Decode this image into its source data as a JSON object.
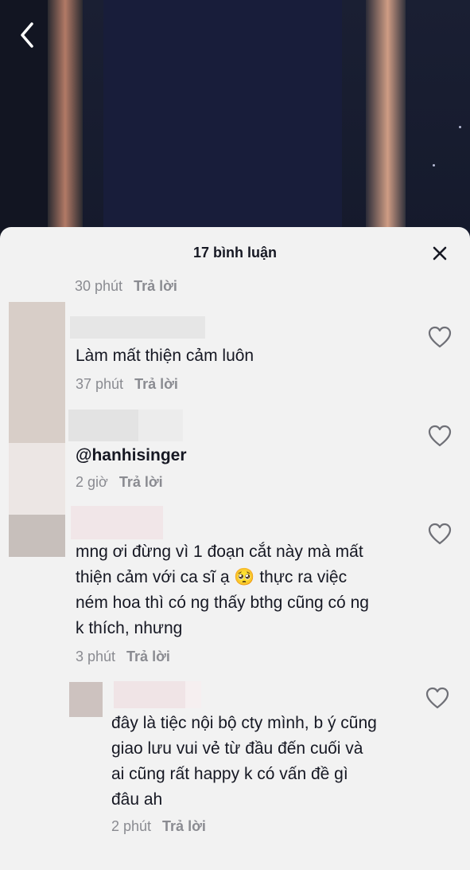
{
  "header": {
    "back_icon": "chevron-left-icon",
    "comment_count_title": "17 bình luận",
    "close_icon": "close-icon"
  },
  "comments": [
    {
      "time": "30 phút",
      "reply_label": "Trả lời",
      "text": ""
    },
    {
      "text": "Làm mất thiện cảm luôn",
      "time": "37 phút",
      "reply_label": "Trả lời",
      "like_icon": "heart-outline-icon"
    },
    {
      "text": "@hanhisinger",
      "time": "2 giờ",
      "reply_label": "Trả lời",
      "like_icon": "heart-outline-icon"
    },
    {
      "text_lines": [
        "mng ơi đừng vì 1 đoạn cắt này mà mất",
        "thiện cảm với ca sĩ ạ 🥺 thực ra việc",
        "ném hoa thì có ng thấy bthg cũng có ng",
        "k thích, nhưng"
      ],
      "time": "3 phút",
      "reply_label": "Trả lời",
      "like_icon": "heart-outline-icon"
    },
    {
      "text_lines": [
        "đây là tiệc nội bộ cty mình, b ý cũng",
        "giao lưu vui vẻ từ đầu đến cuối và",
        "ai cũng rất happy k có vấn đề gì",
        "đâu ah"
      ],
      "time": "2 phút",
      "reply_label": "Trả lời",
      "like_icon": "heart-outline-icon"
    }
  ],
  "colors": {
    "sheet_bg": "#f2f2f2",
    "text_primary": "#161823",
    "text_secondary": "#8a8b91"
  }
}
